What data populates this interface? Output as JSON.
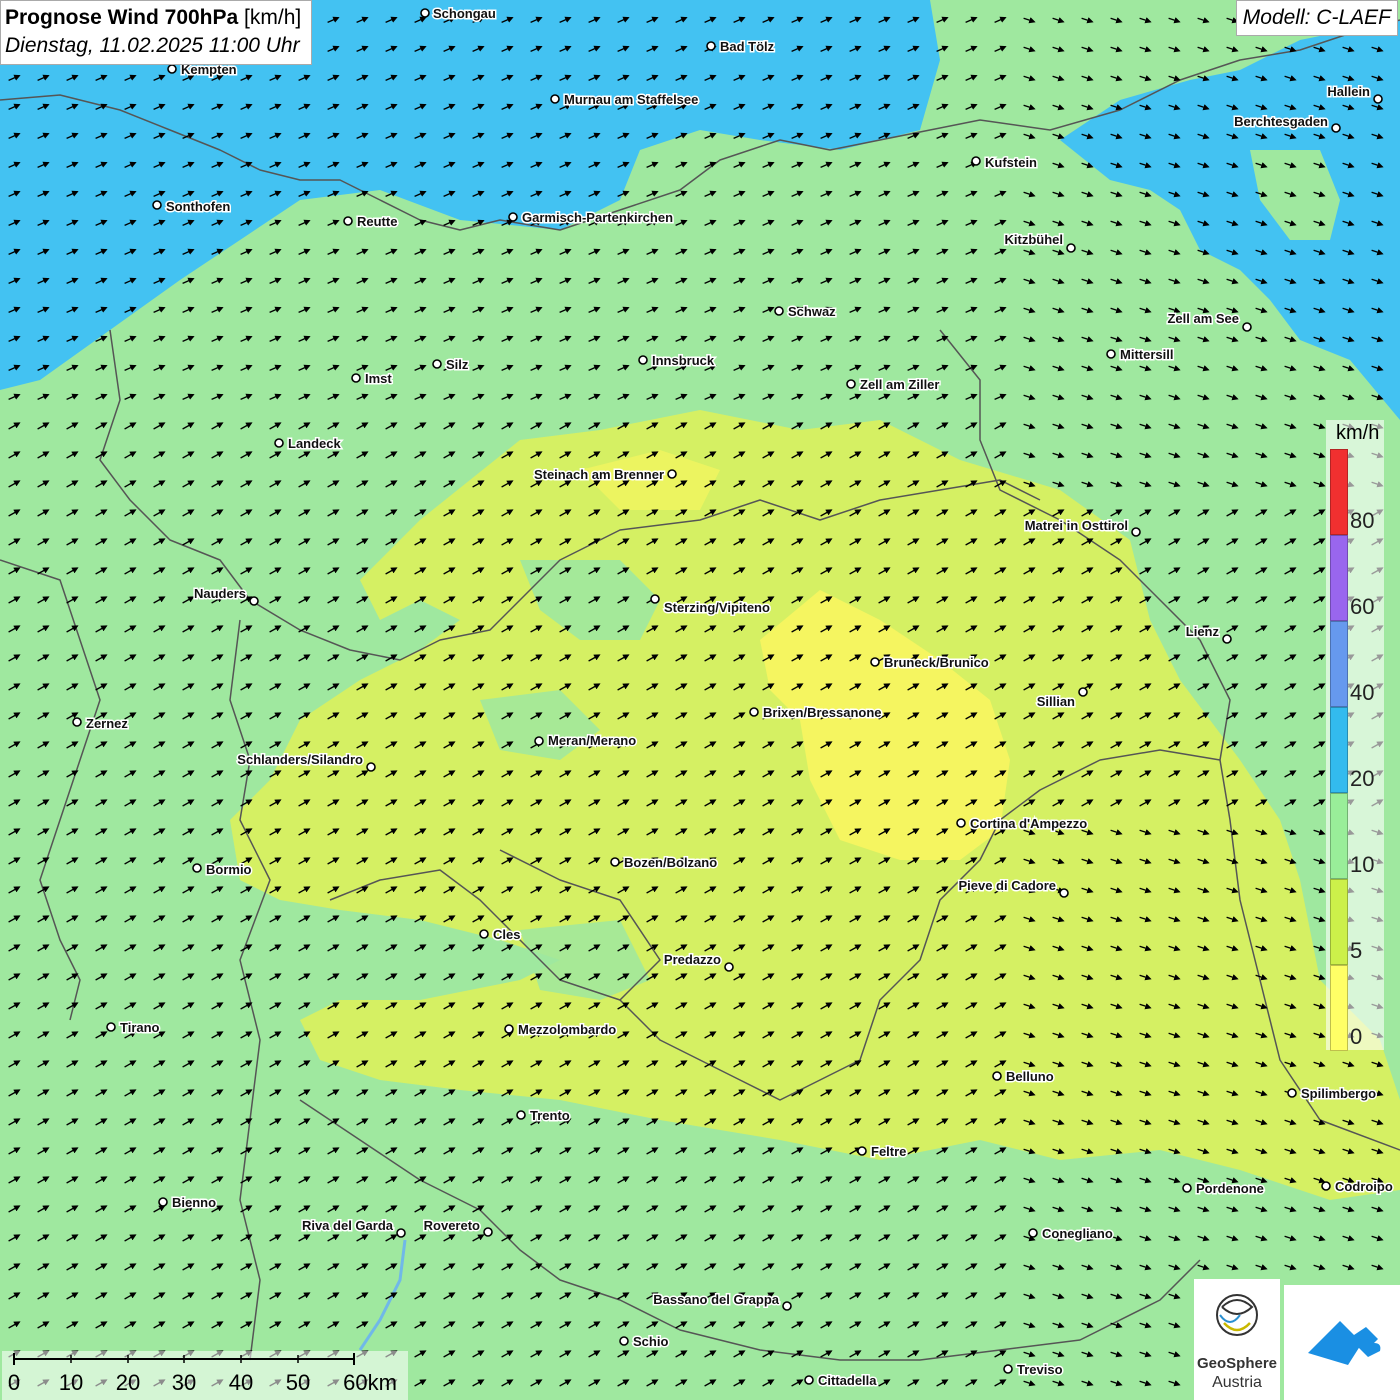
{
  "header": {
    "title_bold": "Prognose Wind 700hPa",
    "title_unit": "[km/h]",
    "subtitle": "Dienstag, 11.02.2025 11:00 Uhr",
    "model": "Modell: C-LAEF"
  },
  "legend": {
    "unit": "km/h",
    "labels": [
      "80",
      "60",
      "40",
      "20",
      "10",
      "5",
      "0"
    ],
    "colors": [
      "#f03030",
      "#9966ee",
      "#6699ee",
      "#33bbee",
      "#99ee99",
      "#ccf04a",
      "#ffff66"
    ]
  },
  "scale_bar": {
    "labels": [
      "0",
      "10",
      "20",
      "30",
      "40",
      "50",
      "60km"
    ]
  },
  "logos": {
    "geosphere_line1": "GeoSphere",
    "geosphere_line2": "Austria"
  },
  "colors": {
    "strong_wind": "#43c2f2",
    "medium_wind": "#9fe89f",
    "light_wind": "#d8f060",
    "calm": "#f5f560",
    "borders": "#555555"
  },
  "wind_direction": "west-southwest (arrows pointing east-northeast)",
  "cities": [
    {
      "name": "Schongau"
    },
    {
      "name": "Bad Tölz"
    },
    {
      "name": "Kempten"
    },
    {
      "name": "Murnau am Staffelsee"
    },
    {
      "name": "Hallein"
    },
    {
      "name": "Berchtesgaden"
    },
    {
      "name": "Kufstein"
    },
    {
      "name": "Sonthofen"
    },
    {
      "name": "Reutte"
    },
    {
      "name": "Garmisch-Partenkirchen"
    },
    {
      "name": "Kitzbühel"
    },
    {
      "name": "Schwaz"
    },
    {
      "name": "Zell am See"
    },
    {
      "name": "Mittersill"
    },
    {
      "name": "Imst"
    },
    {
      "name": "Silz"
    },
    {
      "name": "Innsbruck"
    },
    {
      "name": "Zell am Ziller"
    },
    {
      "name": "Landeck"
    },
    {
      "name": "Steinach am Brenner"
    },
    {
      "name": "Matrei in Osttirol"
    },
    {
      "name": "Nauders"
    },
    {
      "name": "Sterzing/Vipiteno"
    },
    {
      "name": "Lienz"
    },
    {
      "name": "Bruneck/Brunico"
    },
    {
      "name": "Sillian"
    },
    {
      "name": "Zernez"
    },
    {
      "name": "Brixen/Bressanone"
    },
    {
      "name": "Meran/Merano"
    },
    {
      "name": "Schlanders/Silandro"
    },
    {
      "name": "Cortina d'Ampezzo"
    },
    {
      "name": "Bozen/Bolzano"
    },
    {
      "name": "Bormio"
    },
    {
      "name": "Pieve di Cadore"
    },
    {
      "name": "Cles"
    },
    {
      "name": "Predazzo"
    },
    {
      "name": "Tirano"
    },
    {
      "name": "Mezzolombardo"
    },
    {
      "name": "Belluno"
    },
    {
      "name": "Spilimbergo"
    },
    {
      "name": "Trento"
    },
    {
      "name": "Feltre"
    },
    {
      "name": "Pordenone"
    },
    {
      "name": "Codroipo"
    },
    {
      "name": "Bienno"
    },
    {
      "name": "Riva del Garda"
    },
    {
      "name": "Rovereto"
    },
    {
      "name": "Conegliano"
    },
    {
      "name": "Bassano del Grappa"
    },
    {
      "name": "Schio"
    },
    {
      "name": "Treviso"
    },
    {
      "name": "Cittadella"
    }
  ]
}
